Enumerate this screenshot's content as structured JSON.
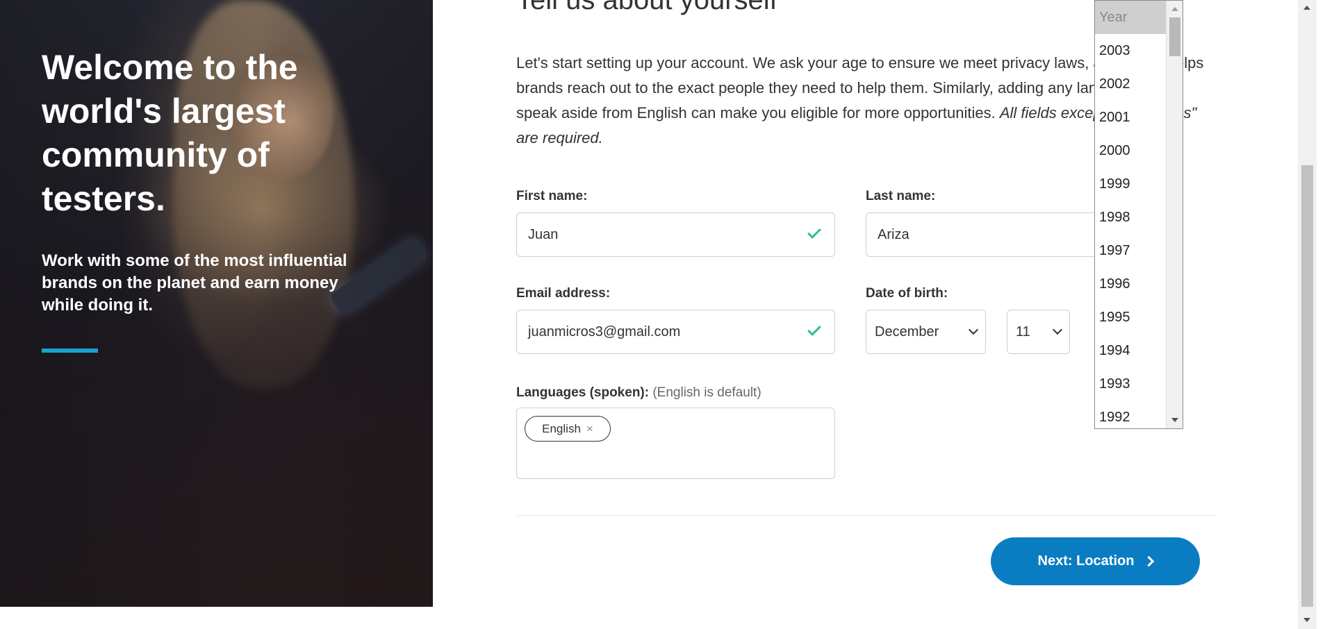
{
  "hero": {
    "headline": "Welcome to the world's largest community of testers.",
    "subheadline": "Work with some of the most influential brands on the planet and earn money while doing it."
  },
  "form": {
    "title": "Tell us about yourself",
    "intro": "Let's start setting up your account. We ask your age to ensure we meet privacy laws, and it also helps brands reach out to the exact people they need to help them. Similarly, adding any languages you speak aside from English can make you eligible for more opportunities.",
    "required_note": "All fields except \"Languages\" are required.",
    "first_name": {
      "label": "First name:",
      "value": "Juan"
    },
    "last_name": {
      "label": "Last name:",
      "value": "Ariza"
    },
    "email": {
      "label": "Email address:",
      "value": "juanmicros3@gmail.com"
    },
    "dob": {
      "label": "Date of birth:",
      "month": "December",
      "day": "11"
    },
    "languages": {
      "label": "Languages (spoken):",
      "hint": "(English is default)",
      "chip": "English",
      "chip_remove": "×"
    },
    "next_button": "Next: Location"
  },
  "year_dropdown": {
    "options": [
      "Year",
      "2003",
      "2002",
      "2001",
      "2000",
      "1999",
      "1998",
      "1997",
      "1996",
      "1995",
      "1994",
      "1993",
      "1992"
    ]
  },
  "colors": {
    "accent": "#1ca0d0",
    "primary_button": "#0a7dc2",
    "check": "#2ec27e"
  }
}
